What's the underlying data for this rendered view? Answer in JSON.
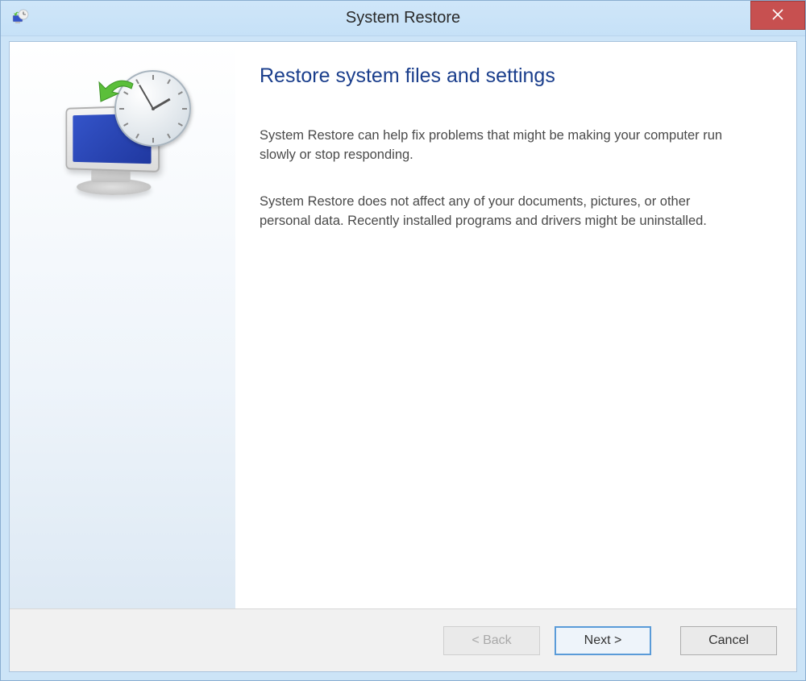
{
  "window": {
    "title": "System Restore"
  },
  "page": {
    "heading": "Restore system files and settings",
    "paragraph1": "System Restore can help fix problems that might be making your computer run slowly or stop responding.",
    "paragraph2": "System Restore does not affect any of your documents, pictures, or other personal data. Recently installed programs and drivers might be uninstalled."
  },
  "buttons": {
    "back": "< Back",
    "next": "Next >",
    "cancel": "Cancel"
  },
  "colors": {
    "titlebar": "#cce4f7",
    "close": "#c75050",
    "heading": "#1a3e8c",
    "highlight_border": "#5a9bd8"
  }
}
